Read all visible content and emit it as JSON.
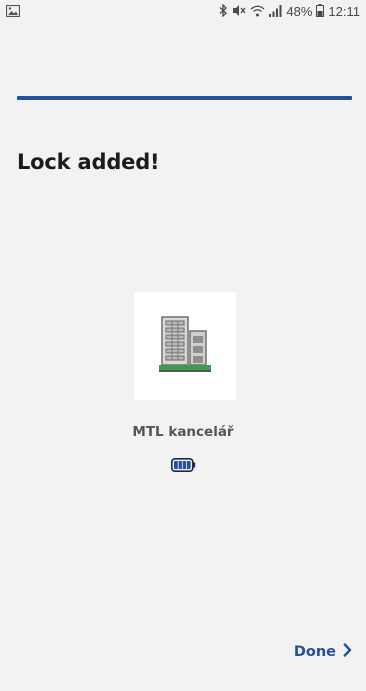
{
  "status_bar": {
    "left_icon": "image-notification-icon",
    "right_icons": [
      "bluetooth-icon",
      "mute-icon",
      "wifi-icon",
      "signal-icon"
    ],
    "battery_percent": "48%",
    "time": "12:11"
  },
  "header": {
    "title": "Lock added!"
  },
  "lock": {
    "icon": "building-icon",
    "name": "MTL kancelář",
    "battery_icon": "battery-full-icon",
    "battery_level": 1.0
  },
  "footer": {
    "done_label": "Done",
    "done_icon": "chevron-right-icon"
  },
  "colors": {
    "accent": "#2450a0",
    "background": "#f2f2f2",
    "building_green": "#3f9b4d"
  }
}
